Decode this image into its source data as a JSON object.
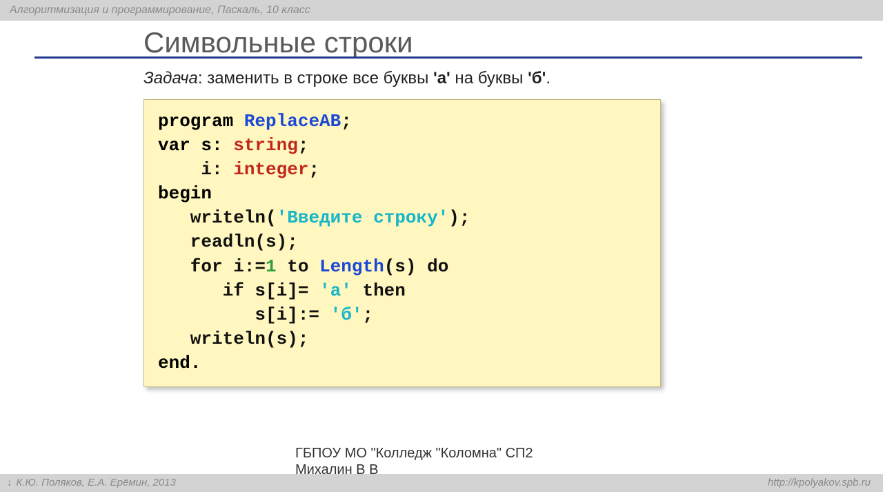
{
  "header": {
    "course": "Алгоритмизация и программирование, Паскаль, 10 класс"
  },
  "title": "Символьные строки",
  "task": {
    "label": "Задача",
    "sep": ": ",
    "body1": "заменить в строке все буквы ",
    "a": "'а'",
    "body2": " на буквы ",
    "b": "'б'",
    "tail": "."
  },
  "code": {
    "t1": "program ",
    "progname": "ReplaceAB",
    "t1b": ";",
    "t2a": "var s: ",
    "type_string": "string",
    "t2b": ";",
    "t3a": "    i: ",
    "type_integer": "integer",
    "t3b": ";",
    "t4": "begin",
    "t5a": "   writeln(",
    "str1": "'Введите строку'",
    "t5b": ");",
    "t6": "   readln(s);",
    "t7a": "   for i:=",
    "num1": "1",
    "t7b": " to ",
    "lenfn": "Length",
    "t7c": "(s) do",
    "t8a": "      if s[i]= ",
    "chrA": "'а'",
    "t8b": " then",
    "t9a": "         s[i]:= ",
    "chrB": "'б'",
    "t9b": ";",
    "t10": "   writeln(s);",
    "t11": "end."
  },
  "org": {
    "line1": "ГБПОУ МО \"Колледж \"Коломна\" СП2",
    "line2": "Михалин В В"
  },
  "footer": {
    "left": "К.Ю. Поляков, Е.А. Ерёмин, 2013",
    "right": "http://kpolyakov.spb.ru"
  }
}
